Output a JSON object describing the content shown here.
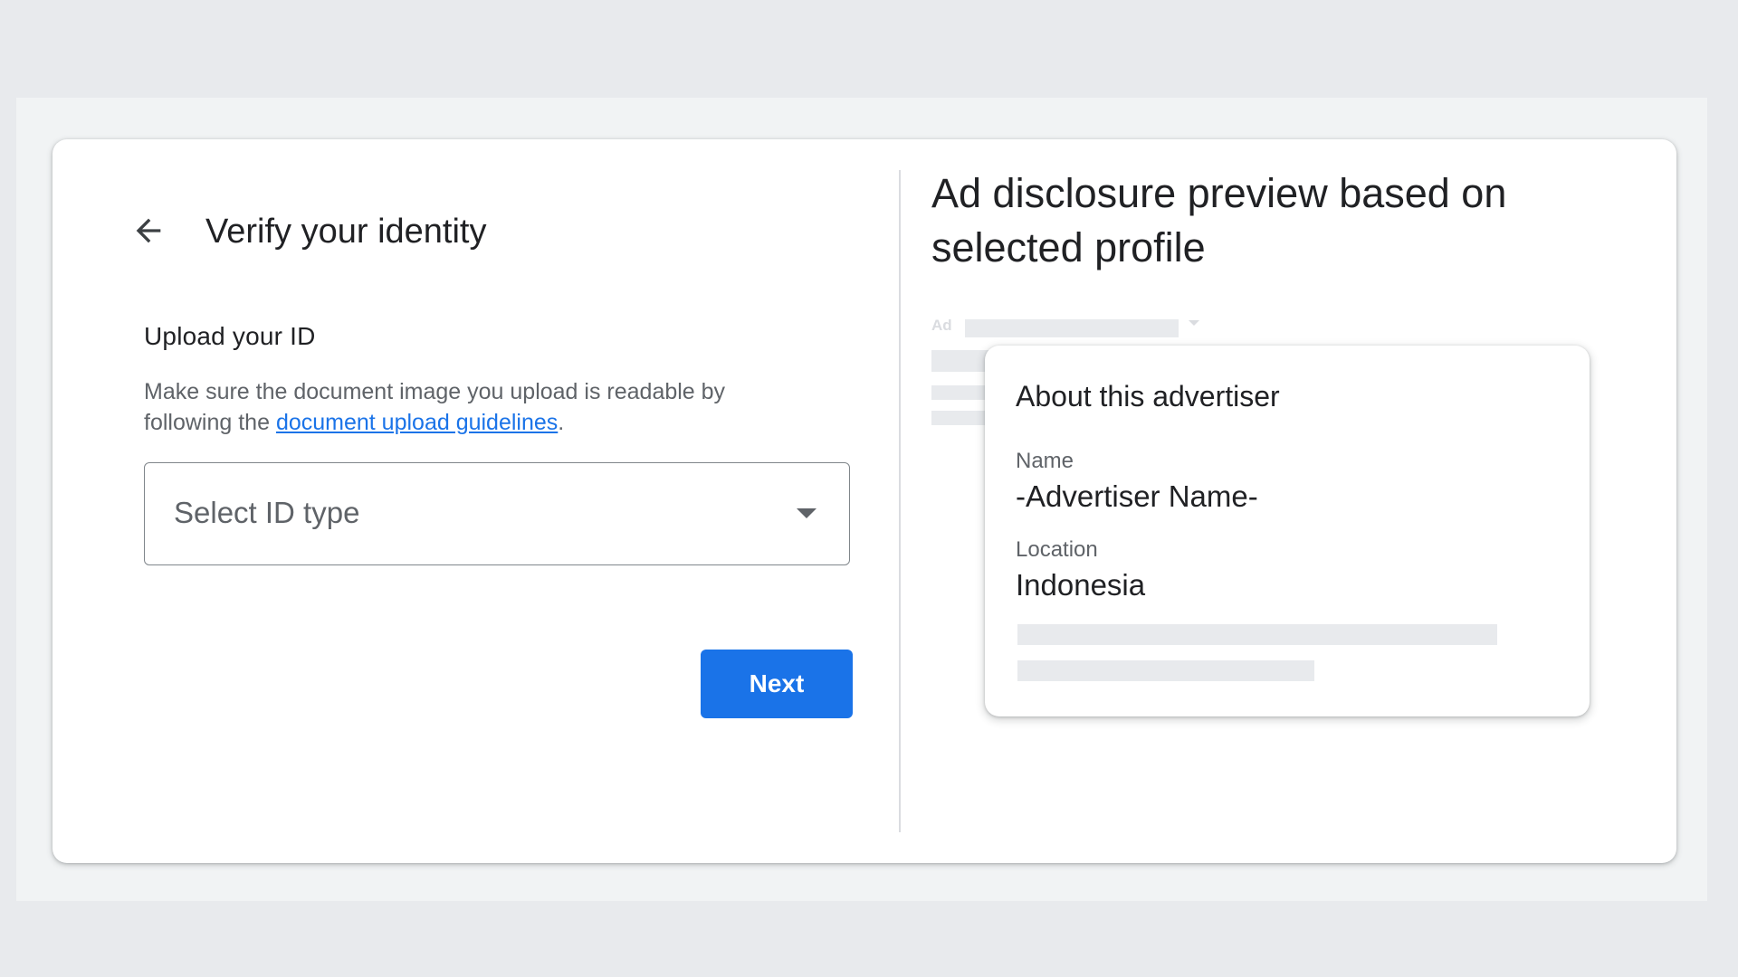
{
  "verify": {
    "back_icon": "arrow-back-icon",
    "title": "Verify your identity",
    "section_title": "Upload your ID",
    "helper_prefix": "Make sure the document image you upload is readable by following the ",
    "helper_link": "document upload guidelines",
    "helper_suffix": ".",
    "select_placeholder": "Select ID type",
    "select_icon": "arrow-drop-down-icon",
    "next_label": "Next"
  },
  "preview": {
    "title": "Ad disclosure preview based on selected profile",
    "ad_label": "Ad",
    "card": {
      "title": "About this advertiser",
      "name_label": "Name",
      "name_value": "-Advertiser Name-",
      "location_label": "Location",
      "location_value": "Indonesia"
    }
  },
  "colors": {
    "accent": "#1a73e8",
    "text_primary": "#202124",
    "text_secondary": "#5f6368",
    "skeleton": "#e8eaed",
    "background": "#e8eaed"
  }
}
